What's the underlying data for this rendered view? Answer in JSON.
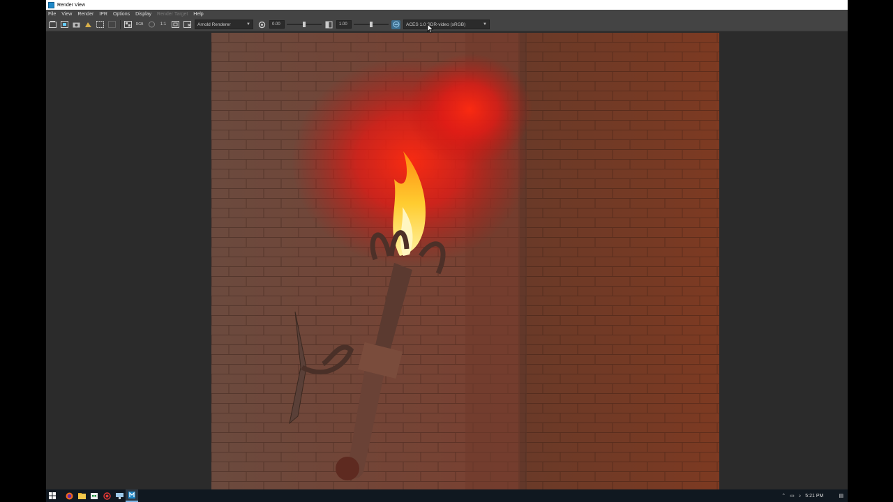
{
  "window": {
    "title": "Render View"
  },
  "menu": {
    "items": [
      {
        "label": "File",
        "enabled": true
      },
      {
        "label": "View",
        "enabled": true
      },
      {
        "label": "Render",
        "enabled": true
      },
      {
        "label": "IPR",
        "enabled": true
      },
      {
        "label": "Options",
        "enabled": true
      },
      {
        "label": "Display",
        "enabled": true
      },
      {
        "label": "Render Target",
        "enabled": false
      },
      {
        "label": "Help",
        "enabled": true
      }
    ]
  },
  "toolbar": {
    "rgb_label": "RGB",
    "one_to_one_label": "1:1",
    "renderer": "Arnold Renderer",
    "exposure": {
      "value": "0.00",
      "level": 0.5
    },
    "gamma": {
      "value": "1.00",
      "level": 0.5
    },
    "view_transform": "ACES 1.0 SDR-video (sRGB)"
  },
  "taskbar": {
    "apps": [
      "start-icon",
      "firefox-icon",
      "file-explorer-icon",
      "store-icon",
      "record-icon",
      "network-drive-icon",
      "maya-icon"
    ],
    "clock": "5:21 PM"
  },
  "colors": {
    "ui_bg": "#444444",
    "viewport_bg": "#2b2b2b",
    "accent": "#3c6e8f",
    "taskbar": "#101820"
  }
}
